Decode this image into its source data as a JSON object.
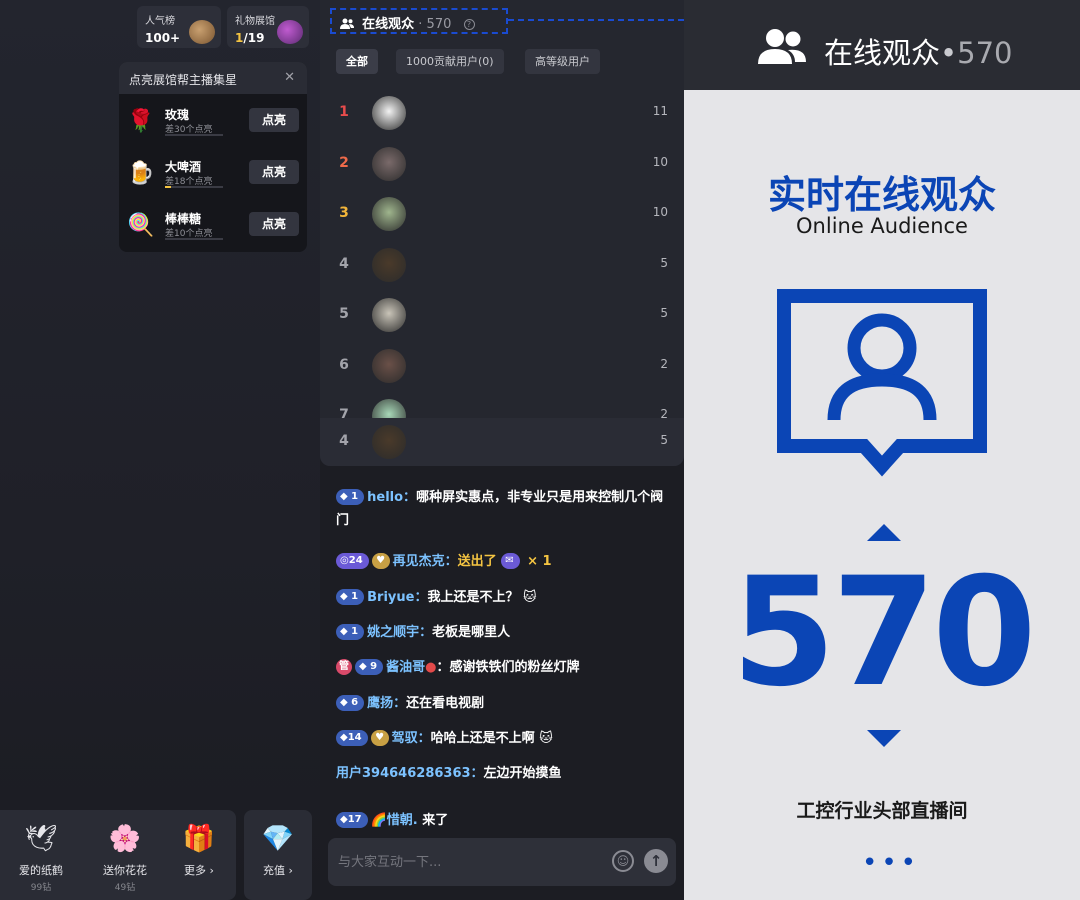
{
  "top_cards": {
    "popularity": {
      "title": "人气榜",
      "value": "100+"
    },
    "gift_hall": {
      "title": "礼物展馆",
      "value_current": "1",
      "value_total": "/19"
    }
  },
  "star_panel": {
    "title": "点亮展馆帮主播集星",
    "items": [
      {
        "name": "玫瑰",
        "sub": "差30个点亮",
        "btn": "点亮",
        "progress": 0.0,
        "icon": "rose-icon"
      },
      {
        "name": "大啤酒",
        "sub": "差18个点亮",
        "btn": "点亮",
        "progress": 0.1,
        "icon": "beer-icon"
      },
      {
        "name": "棒棒糖",
        "sub": "差10个点亮",
        "btn": "点亮",
        "progress": 0.0,
        "icon": "lollipop-icon"
      }
    ]
  },
  "gift_bar": {
    "items": [
      {
        "label": "爱的纸鹤",
        "price": "99钻",
        "icon": "paper-crane-icon"
      },
      {
        "label": "送你花花",
        "price": "49钻",
        "icon": "flower-icon"
      },
      {
        "label": "更多",
        "icon": "gift-box-icon"
      }
    ],
    "recharge": {
      "label": "充值",
      "icon": "diamond-icon"
    }
  },
  "audience": {
    "title": "在线观众",
    "count": "· 570",
    "filters": [
      "全部",
      "1000贡献用户(0)",
      "高等级用户"
    ],
    "rows": [
      {
        "rank": "1",
        "score": "11",
        "rank_color": "#e84c4c",
        "avatar_color": "#f2f2f2"
      },
      {
        "rank": "2",
        "score": "10",
        "rank_color": "#ef6a4a",
        "avatar_color": "#7a6a6a"
      },
      {
        "rank": "3",
        "score": "10",
        "rank_color": "#f2b53a",
        "avatar_color": "#9fb58d"
      },
      {
        "rank": "4",
        "score": "5",
        "rank_color": "#a3a4ab",
        "avatar_color": "#4a3a2a"
      },
      {
        "rank": "5",
        "score": "5",
        "rank_color": "#a3a4ab",
        "avatar_color": "#c9c4b8"
      },
      {
        "rank": "6",
        "score": "2",
        "rank_color": "#a3a4ab",
        "avatar_color": "#6a5048"
      },
      {
        "rank": "7",
        "score": "2",
        "rank_color": "#a3a4ab",
        "avatar_color": "#a8d8b8"
      }
    ],
    "sticky": {
      "rank": "4",
      "score": "5",
      "avatar_color": "#4a3a2a"
    }
  },
  "chat": {
    "messages": [
      {
        "badge": "1",
        "user": "hello：",
        "text": "哪种屏实惠点，非专业只是用来控制几个阀门"
      },
      {
        "badge": "24",
        "user": "再见杰克：",
        "sent": "送出了",
        "count": "× 1"
      },
      {
        "badge": "1",
        "user": "Briyue：",
        "text": "我上还是不上？"
      },
      {
        "badge": "1",
        "user": "姚之顺宇：",
        "text": "老板是哪里人"
      },
      {
        "badge": "9",
        "user": "酱油哥",
        "text": "：感谢铁铁们的粉丝灯牌"
      },
      {
        "badge": "6",
        "user": "鹰扬：",
        "text": "还在看电视剧"
      },
      {
        "badge": "14",
        "user": "驾驭：",
        "text": "哈哈上还是不上啊"
      },
      {
        "user": "用户394646286363：",
        "text": "左边开始摸鱼"
      },
      {
        "badge": "17",
        "user": "🌈惜朝.",
        "text": " 来了"
      }
    ],
    "input_placeholder": "与大家互动一下..."
  },
  "right_panel": {
    "header_title": "在线观众",
    "header_dot": "•",
    "header_count": "570",
    "big_title": "实时在线观众",
    "subtitle": "Online Audience",
    "big_number": "570",
    "caption": "工控行业头部直播间",
    "more": "•••",
    "accent": "#0b45b5"
  }
}
